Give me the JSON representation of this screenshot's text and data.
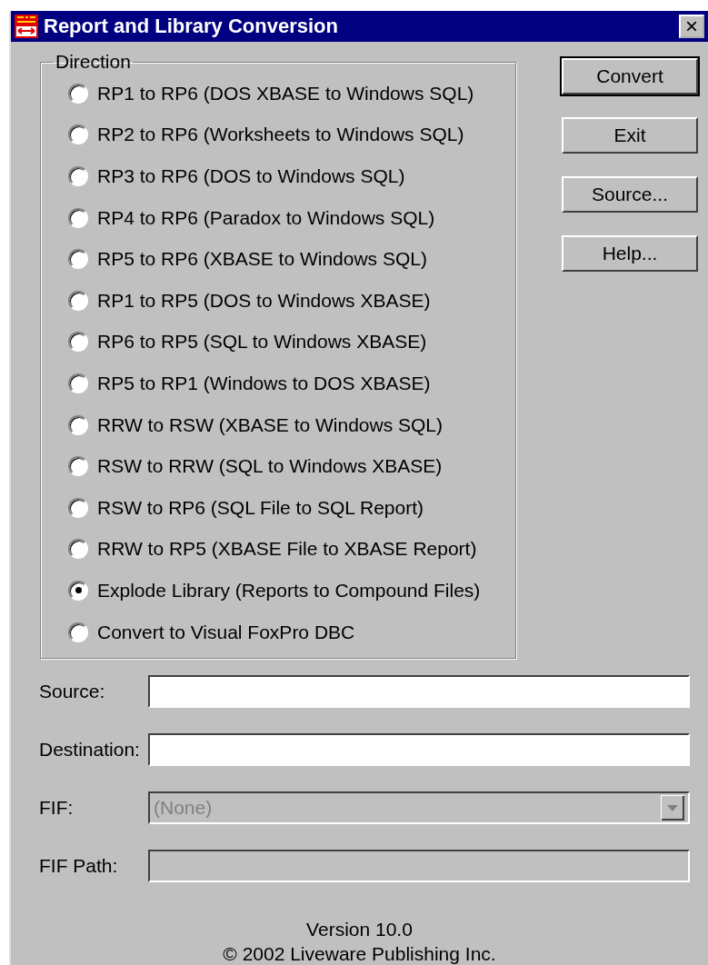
{
  "window": {
    "title": "Report and Library Conversion",
    "close": "×"
  },
  "direction": {
    "label": "Direction",
    "options": [
      {
        "label": "RP1 to RP6 (DOS XBASE to Windows SQL)",
        "selected": false
      },
      {
        "label": "RP2 to RP6 (Worksheets to Windows SQL)",
        "selected": false
      },
      {
        "label": "RP3 to RP6 (DOS to Windows SQL)",
        "selected": false
      },
      {
        "label": "RP4 to RP6 (Paradox to Windows SQL)",
        "selected": false
      },
      {
        "label": "RP5 to RP6 (XBASE to Windows SQL)",
        "selected": false
      },
      {
        "label": "RP1 to RP5 (DOS to Windows XBASE)",
        "selected": false
      },
      {
        "label": "RP6 to RP5 (SQL to Windows XBASE)",
        "selected": false
      },
      {
        "label": "RP5 to RP1 (Windows to DOS XBASE)",
        "selected": false
      },
      {
        "label": "RRW to RSW (XBASE to Windows SQL)",
        "selected": false
      },
      {
        "label": "RSW to RRW (SQL to Windows XBASE)",
        "selected": false
      },
      {
        "label": "RSW to RP6 (SQL File to SQL Report)",
        "selected": false
      },
      {
        "label": "RRW to RP5 (XBASE File to XBASE Report)",
        "selected": false
      },
      {
        "label": "Explode Library (Reports to Compound Files)",
        "selected": true
      },
      {
        "label": "Convert to Visual FoxPro DBC",
        "selected": false
      }
    ]
  },
  "buttons": [
    {
      "label": "Convert",
      "default": true
    },
    {
      "label": "Exit",
      "default": false
    },
    {
      "label": "Source...",
      "default": false
    },
    {
      "label": "Help...",
      "default": false
    }
  ],
  "fields": [
    {
      "label": "Source:",
      "kind": "text",
      "disabled": false
    },
    {
      "label": "Destination:",
      "kind": "text",
      "disabled": false
    },
    {
      "label": "FIF:",
      "kind": "dropdown",
      "disabled": true,
      "value": "(None)"
    },
    {
      "label": "FIF Path:",
      "kind": "text",
      "disabled": true
    }
  ],
  "footer": {
    "version": "Version 10.0",
    "copyright": "© 2002 Liveware Publishing Inc."
  }
}
